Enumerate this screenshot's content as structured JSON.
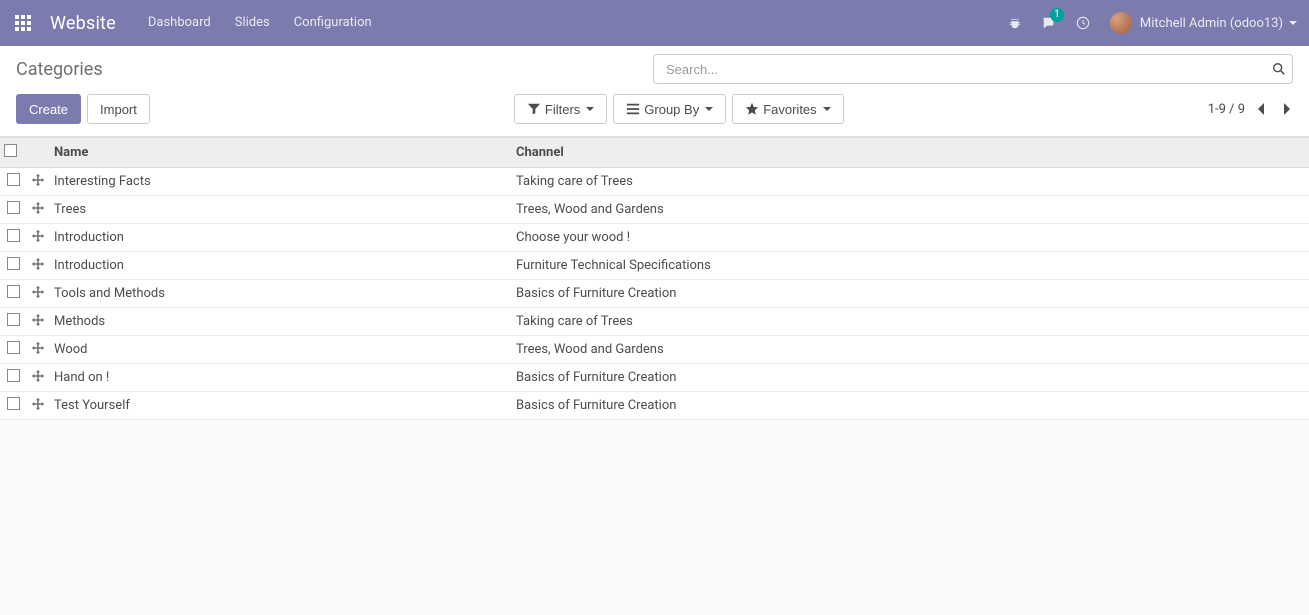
{
  "navbar": {
    "brand": "Website",
    "menu": [
      "Dashboard",
      "Slides",
      "Configuration"
    ],
    "messages_count": "1",
    "user_label": "Mitchell Admin (odoo13)"
  },
  "breadcrumb": "Categories",
  "search": {
    "placeholder": "Search..."
  },
  "buttons": {
    "create": "Create",
    "import": "Import",
    "filters": "Filters",
    "group_by": "Group By",
    "favorites": "Favorites"
  },
  "pager": {
    "label": "1-9 / 9"
  },
  "table": {
    "headers": {
      "name": "Name",
      "channel": "Channel"
    },
    "rows": [
      {
        "name": "Interesting Facts",
        "channel": "Taking care of Trees"
      },
      {
        "name": "Trees",
        "channel": "Trees, Wood and Gardens"
      },
      {
        "name": "Introduction",
        "channel": "Choose your wood !"
      },
      {
        "name": "Introduction",
        "channel": "Furniture Technical Specifications"
      },
      {
        "name": "Tools and Methods",
        "channel": "Basics of Furniture Creation"
      },
      {
        "name": "Methods",
        "channel": "Taking care of Trees"
      },
      {
        "name": "Wood",
        "channel": "Trees, Wood and Gardens"
      },
      {
        "name": "Hand on !",
        "channel": "Basics of Furniture Creation"
      },
      {
        "name": "Test Yourself",
        "channel": "Basics of Furniture Creation"
      }
    ]
  },
  "colors": {
    "primary": "#7c7bad",
    "badge": "#00a09d"
  }
}
